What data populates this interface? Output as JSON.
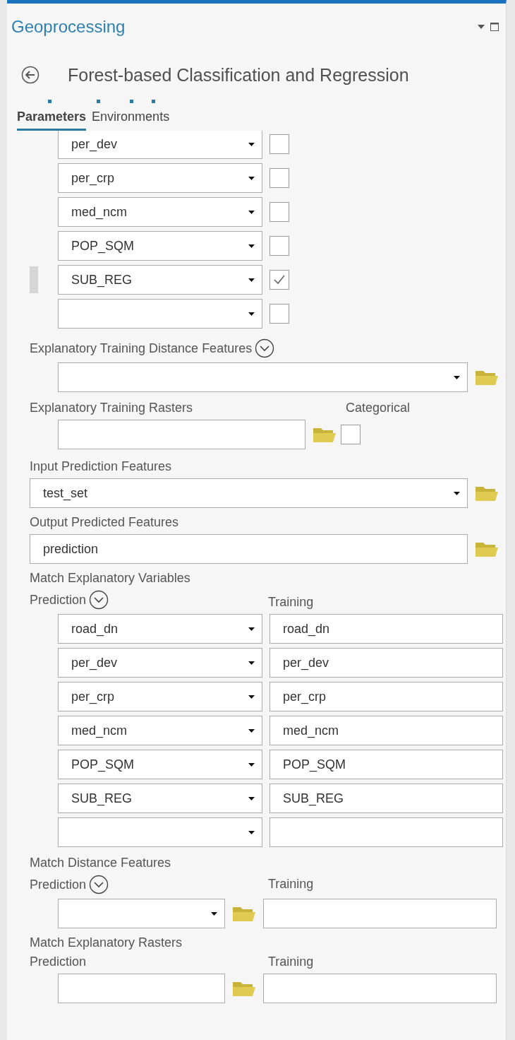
{
  "pane": {
    "title": "Geoprocessing"
  },
  "tool": {
    "title": "Forest-based Classification and Regression"
  },
  "tabs": [
    {
      "label": "Parameters",
      "selected": true
    },
    {
      "label": "Environments",
      "selected": false
    }
  ],
  "explanatory_variables": [
    {
      "value": "per_dev",
      "checked": false,
      "highlighted": false
    },
    {
      "value": "per_crp",
      "checked": false,
      "highlighted": false
    },
    {
      "value": "med_ncm",
      "checked": false,
      "highlighted": false
    },
    {
      "value": "POP_SQM",
      "checked": false,
      "highlighted": false
    },
    {
      "value": "SUB_REG",
      "checked": true,
      "highlighted": true
    },
    {
      "checked": false,
      "highlighted": false
    }
  ],
  "distance_features": {
    "label": "Explanatory Training Distance Features",
    "expanded": false
  },
  "training_rasters": {
    "label": "Explanatory Training Rasters",
    "categorical_label": "Categorical",
    "categorical": false
  },
  "input_prediction": {
    "label": "Input Prediction Features",
    "value": "test_set"
  },
  "output_predicted": {
    "label": "Output Predicted Features",
    "value": "prediction"
  },
  "match_variables": {
    "label": "Match Explanatory Variables",
    "prediction_label": "Prediction",
    "training_label": "Training",
    "expanded": false,
    "rows": [
      {
        "prediction": "road_dn",
        "training": "road_dn"
      },
      {
        "prediction": "per_dev",
        "training": "per_dev"
      },
      {
        "prediction": "per_crp",
        "training": "per_crp"
      },
      {
        "prediction": "med_ncm",
        "training": "med_ncm"
      },
      {
        "prediction": "POP_SQM",
        "training": "POP_SQM"
      },
      {
        "prediction": "SUB_REG",
        "training": "SUB_REG"
      },
      {}
    ]
  },
  "match_distance": {
    "label": "Match Distance Features",
    "prediction_label": "Prediction",
    "training_label": "Training",
    "expanded": false
  },
  "match_rasters": {
    "label": "Match Explanatory Rasters",
    "prediction_label": "Prediction",
    "training_label": "Training"
  }
}
